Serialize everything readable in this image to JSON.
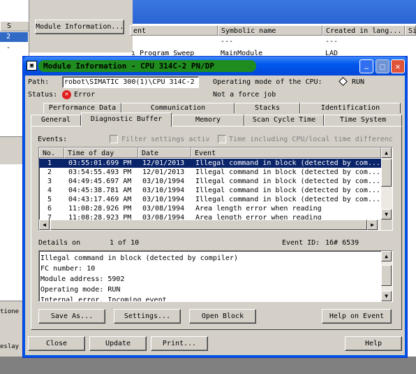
{
  "background_app": {
    "left_panel": {
      "header": "S",
      "items": [
        "2",
        "-"
      ]
    },
    "module_info_button": "Module Information...",
    "table_headers": [
      "ent",
      "Symbolic name",
      "Created in lang...",
      "Si"
    ],
    "row1": {
      "symbolic": "---",
      "created": "---"
    },
    "row2": {
      "prefix": "ı Program Sweep",
      "symbolic": "MainModule",
      "created": "LAD"
    },
    "bottom_left_1": "tione",
    "bottom_left_2": "eslay"
  },
  "window": {
    "title": "Module Information - CPU 314C-2 PN/DP",
    "controls": {
      "minimize": "_",
      "maximize": "□",
      "close": "✕"
    }
  },
  "path": {
    "label": "Path:",
    "value": "robot\\SIMATIC 300(1)\\CPU 314C-2"
  },
  "status": {
    "label": "Status:",
    "value": "Error"
  },
  "operating_mode": {
    "label": "Operating mode of the  CPU:",
    "value": "RUN"
  },
  "force_job": "Not a force job",
  "tabs_row1": [
    "Performance Data",
    "Communication",
    "Stacks",
    "Identification"
  ],
  "tabs_row2": [
    "General",
    "Diagnostic Buffer",
    "Memory",
    "Scan Cycle Time",
    "Time System"
  ],
  "active_tab": "Diagnostic Buffer",
  "events": {
    "label": "Events:",
    "filter_label": "Filter settings activ",
    "time_label": "Time including CPU/local time differenc",
    "columns": [
      "No.",
      "Time of day",
      "Date",
      "Event"
    ],
    "rows": [
      {
        "no": "1",
        "time": "03:55:01.699 PM",
        "date": "12/01/2013",
        "event": "Illegal command in block (detected by com..."
      },
      {
        "no": "2",
        "time": "03:54:55.493 PM",
        "date": "12/01/2013",
        "event": "Illegal command in block (detected by com..."
      },
      {
        "no": "3",
        "time": "04:49:45.697 AM",
        "date": "03/10/1994",
        "event": "Illegal command in block (detected by com..."
      },
      {
        "no": "4",
        "time": "04:45:38.781 AM",
        "date": "03/10/1994",
        "event": "Illegal command in block (detected by com..."
      },
      {
        "no": "5",
        "time": "04:43:17.469 AM",
        "date": "03/10/1994",
        "event": "Illegal command in block (detected by com..."
      },
      {
        "no": "6",
        "time": "11:08:28.926 PM",
        "date": "03/08/1994",
        "event": "Area length error when reading"
      },
      {
        "no": "7",
        "time": "11:08:28.923 PM",
        "date": "03/08/1994",
        "event": "Area length error when reading"
      }
    ]
  },
  "details": {
    "label": "Details on",
    "count": "1 of 10",
    "event_id_label": "Event ID:",
    "event_id_value": "16# 6539",
    "lines": [
      "Illegal command in block (detected by compiler)",
      "FC number:    10",
      "Module address:    5902",
      "Operating mode: RUN",
      "Internal error, Incoming event"
    ]
  },
  "buttons_inner": {
    "save_as": "Save As...",
    "settings": "Settings...",
    "open_block": "Open Block",
    "help_on_event": "Help on Event"
  },
  "buttons_outer": {
    "close": "Close",
    "update": "Update",
    "print": "Print...",
    "help": "Help"
  },
  "colors": {
    "title_green": "#1e8c1e",
    "selection": "#0a246a",
    "face": "#d4d0c8",
    "xp_blue": "#2a63d4"
  }
}
